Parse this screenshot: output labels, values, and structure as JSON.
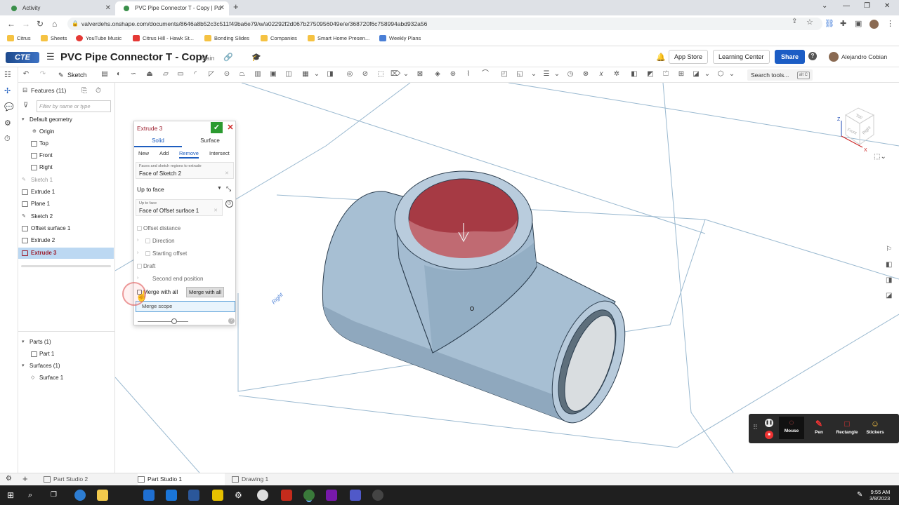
{
  "browser": {
    "tabs": [
      {
        "title": "Activity"
      },
      {
        "title": "PVC Pipe Connector T - Copy | Pa"
      }
    ],
    "new_tab": "+",
    "url": "valverdehs.onshape.com/documents/8646a8b52c3c511f49ba6e79/w/a02292f2d067b2750956049e/e/368720f6c758994abd932a56",
    "bookmarks": [
      {
        "label": "Citrus",
        "color": "#f5c242"
      },
      {
        "label": "Sheets",
        "color": "#f5c242"
      },
      {
        "label": "YouTube Music",
        "color": "#e53935"
      },
      {
        "label": "Citrus Hill - Hawk St...",
        "color": "#e53935"
      },
      {
        "label": "Bonding Slides",
        "color": "#f5c242"
      },
      {
        "label": "Companies",
        "color": "#f5c242"
      },
      {
        "label": "Smart Home Presen...",
        "color": "#f5c242"
      },
      {
        "label": "Weekly Plans",
        "color": "#4a7fd6"
      }
    ]
  },
  "app": {
    "logo": "CTE",
    "title": "PVC Pipe Connector T - Copy",
    "branch": "Main",
    "app_store": "App Store",
    "learning_center": "Learning Center",
    "share": "Share",
    "help": "?",
    "user": "Alejandro Cobian",
    "sketch": "Sketch",
    "search_tools": "Search tools...",
    "search_shortcut": "alt C"
  },
  "features": {
    "header": "Features (11)",
    "filter_placeholder": "Filter by name or type",
    "items": [
      {
        "label": "Default geometry"
      },
      {
        "label": "Origin"
      },
      {
        "label": "Top"
      },
      {
        "label": "Front"
      },
      {
        "label": "Right"
      },
      {
        "label": "Sketch 1"
      },
      {
        "label": "Extrude 1"
      },
      {
        "label": "Plane 1"
      },
      {
        "label": "Sketch 2"
      },
      {
        "label": "Offset surface 1"
      },
      {
        "label": "Extrude 2"
      },
      {
        "label": "Extrude 3"
      }
    ],
    "parts_header": "Parts (1)",
    "part": "Part 1",
    "surfaces_header": "Surfaces (1)",
    "surface": "Surface 1"
  },
  "dialog": {
    "title": "Extrude 3",
    "tab_solid": "Solid",
    "tab_surface": "Surface",
    "op_new": "New",
    "op_add": "Add",
    "op_remove": "Remove",
    "op_intersect": "Intersect",
    "faces_caption": "Faces and sketch regions to extrude",
    "faces_value": "Face of Sketch 2",
    "end_type": "Up to face",
    "upto_caption": "Up to face",
    "upto_value": "Face of Offset surface 1",
    "offset_distance": "Offset distance",
    "direction": "Direction",
    "starting_offset": "Starting offset",
    "draft": "Draft",
    "second_end": "Second end position",
    "merge_with_all": "Merge with all",
    "tooltip": "Merge with all",
    "merge_scope": "Merge scope"
  },
  "viewport": {
    "plane_label": "Right",
    "cube_top": "Top",
    "cube_front": "Front",
    "cube_right": "Right",
    "axis_z": "Z",
    "axis_x": "X"
  },
  "recorder": {
    "mouse": "Mouse",
    "pen": "Pen",
    "rectangle": "Rectangle",
    "stickers": "Stickers"
  },
  "bottom_tabs": [
    {
      "label": "Part Studio 2"
    },
    {
      "label": "Part Studio 1"
    },
    {
      "label": "Drawing 1"
    }
  ],
  "taskbar": {
    "time": "9:55 AM",
    "date": "3/8/2023"
  },
  "colors": {
    "accent": "#1c5dc5",
    "pipe": "#a7bfd3",
    "cut_face": "#a63a44",
    "selected_feature": "#bcd8f2"
  }
}
